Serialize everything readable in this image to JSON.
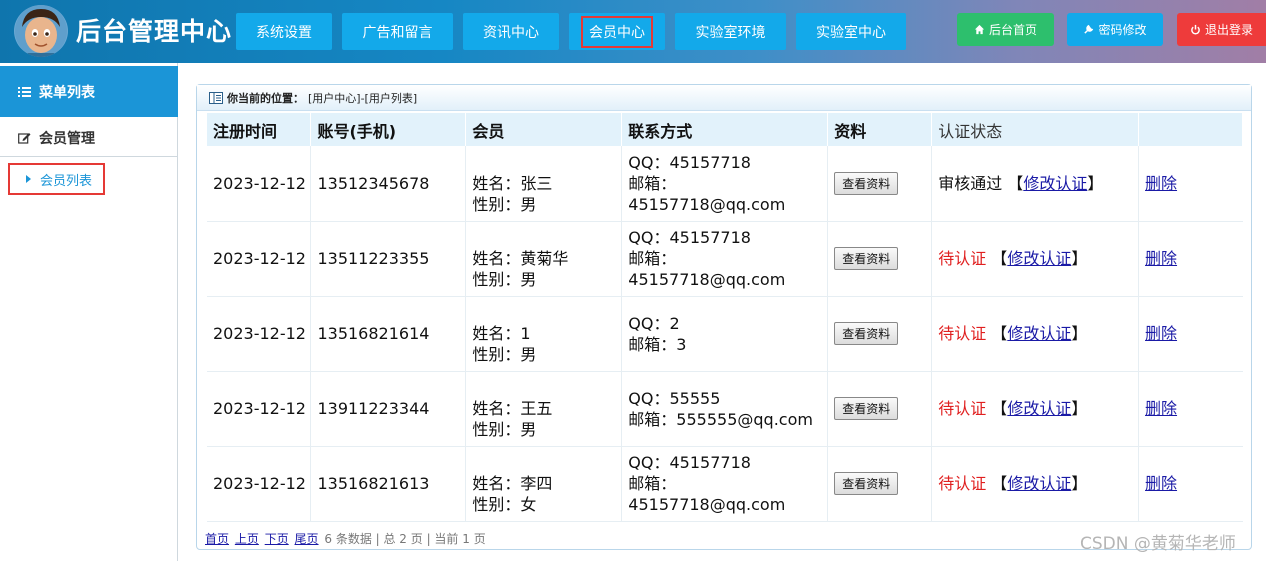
{
  "header": {
    "title": "后台管理中心",
    "nav": [
      {
        "label": "系统设置"
      },
      {
        "label": "广告和留言"
      },
      {
        "label": "资讯中心"
      },
      {
        "label": "会员中心"
      },
      {
        "label": "实验室环境"
      },
      {
        "label": "实验室中心"
      }
    ],
    "home_label": "后台首页",
    "password_label": "密码修改",
    "logout_label": "退出登录",
    "colors": {
      "home": "#2dbf6d",
      "password": "#13a9ea",
      "logout": "#ee3b3b"
    }
  },
  "sidebar": {
    "menu_title": "菜单列表",
    "group_label": "会员管理",
    "item_label": "会员列表"
  },
  "panel": {
    "location_label": "你当前的位置：",
    "location_path": "[用户中心]-[用户列表]"
  },
  "table": {
    "columns": [
      "注册时间",
      "账号(手机)",
      "会员",
      "联系方式",
      "资料",
      "认证状态",
      ""
    ],
    "view_label": "查看资料",
    "modify_label": "修改认证",
    "delete_label": "删除",
    "rows": [
      {
        "date": "2023-12-12",
        "phone": "13512345678",
        "name": "姓名：张三",
        "gender": "性别：男",
        "qq": "QQ：45157718",
        "email1": "邮箱：",
        "email2": "45157718@qq.com",
        "status": "审核通过"
      },
      {
        "date": "2023-12-12",
        "phone": "13511223355",
        "name": "姓名：黄菊华",
        "gender": "性别：男",
        "qq": "QQ：45157718",
        "email1": "邮箱：",
        "email2": "45157718@qq.com",
        "status": "待认证"
      },
      {
        "date": "2023-12-12",
        "phone": "13516821614",
        "name": "姓名：1",
        "gender": "性别：男",
        "qq": "QQ：2",
        "email1": "邮箱：3",
        "email2": "",
        "status": "待认证"
      },
      {
        "date": "2023-12-12",
        "phone": "13911223344",
        "name": "姓名：王五",
        "gender": "性别：男",
        "qq": "QQ：55555",
        "email1": "邮箱：555555@qq.com",
        "email2": "",
        "status": "待认证"
      },
      {
        "date": "2023-12-12",
        "phone": "13516821613",
        "name": "姓名：李四",
        "gender": "性别：女",
        "qq": "QQ：45157718",
        "email1": "邮箱：",
        "email2": "45157718@qq.com",
        "status": "待认证"
      }
    ]
  },
  "pager": {
    "first": "首页",
    "prev": "上页",
    "next": "下页",
    "last": "尾页",
    "info": "6 条数据 | 总 2 页 | 当前 1 页"
  },
  "watermark": "CSDN @黄菊华老师"
}
